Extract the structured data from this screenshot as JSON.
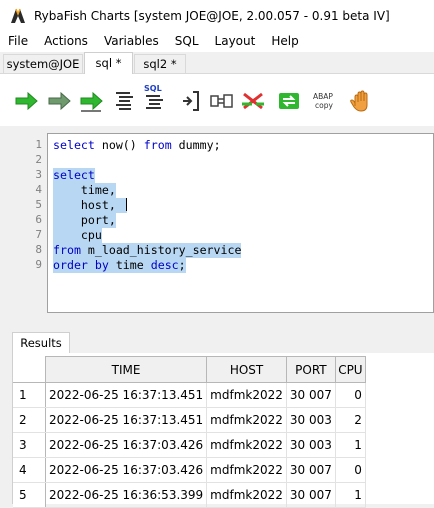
{
  "window": {
    "title": "RybaFish Charts [system JOE@JOE, 2.00.057 - 0.91 beta IV]"
  },
  "menu": [
    "File",
    "Actions",
    "Variables",
    "SQL",
    "Layout",
    "Help"
  ],
  "tabs": [
    {
      "label": "system@JOE",
      "active": false
    },
    {
      "label": "sql *",
      "active": true
    },
    {
      "label": "sql2 *",
      "active": false
    }
  ],
  "toolbar": {
    "buttons": [
      {
        "icon": "run-arrow-green-icon"
      },
      {
        "icon": "run-arrow-gray-icon"
      },
      {
        "icon": "run-all-arrow-icon"
      },
      {
        "icon": "format-text-icon"
      },
      {
        "icon": "sql-format-icon",
        "label": "SQL"
      },
      {
        "icon": "bracket-indent-icon"
      },
      {
        "icon": "connect-plug-icon"
      },
      {
        "icon": "disconnect-red-x-icon"
      },
      {
        "icon": "refresh-green-icon"
      },
      {
        "icon": "abap-copy-icon",
        "label_top": "ABAP",
        "label_bottom": "copy"
      },
      {
        "icon": "hand-stop-icon"
      }
    ]
  },
  "editor": {
    "lines": [
      {
        "n": "1",
        "tokens": [
          [
            "k",
            "select"
          ],
          [
            "t",
            " now() "
          ],
          [
            "k",
            "from"
          ],
          [
            "t",
            " dummy;"
          ]
        ],
        "selected": false
      },
      {
        "n": "2",
        "tokens": [],
        "selected": false
      },
      {
        "n": "3",
        "tokens": [
          [
            "k",
            "select"
          ]
        ],
        "selected": true
      },
      {
        "n": "4",
        "tokens": [
          [
            "t",
            "    time,"
          ]
        ],
        "selected": true
      },
      {
        "n": "5",
        "tokens": [
          [
            "t",
            "    host, "
          ]
        ],
        "selected": true,
        "caret": true
      },
      {
        "n": "6",
        "tokens": [
          [
            "t",
            "    port,"
          ]
        ],
        "selected": true
      },
      {
        "n": "7",
        "tokens": [
          [
            "t",
            "    cpu"
          ]
        ],
        "selected": true
      },
      {
        "n": "8",
        "tokens": [
          [
            "k",
            "from"
          ],
          [
            "t",
            " m_load_history_service"
          ]
        ],
        "selected": true
      },
      {
        "n": "9",
        "tokens": [
          [
            "k",
            "order by"
          ],
          [
            "t",
            " time "
          ],
          [
            "k",
            "desc"
          ],
          [
            "t",
            ";"
          ]
        ],
        "selected": true
      }
    ]
  },
  "results": {
    "tab_label": "Results",
    "columns": [
      "TIME",
      "HOST",
      "PORT",
      "CPU"
    ],
    "rows": [
      {
        "n": "1",
        "cells": [
          "2022-06-25 16:37:13.451",
          "mdfmk2022",
          "30 007",
          "0"
        ]
      },
      {
        "n": "2",
        "cells": [
          "2022-06-25 16:37:13.451",
          "mdfmk2022",
          "30 003",
          "2"
        ]
      },
      {
        "n": "3",
        "cells": [
          "2022-06-25 16:37:03.426",
          "mdfmk2022",
          "30 003",
          "1"
        ]
      },
      {
        "n": "4",
        "cells": [
          "2022-06-25 16:37:03.426",
          "mdfmk2022",
          "30 007",
          "0"
        ]
      },
      {
        "n": "5",
        "cells": [
          "2022-06-25 16:36:53.399",
          "mdfmk2022",
          "30 007",
          "1"
        ]
      }
    ]
  },
  "colors": {
    "keyword": "#0000c8",
    "selection": "#b8d7f2",
    "run_green": "#2fb82f"
  }
}
